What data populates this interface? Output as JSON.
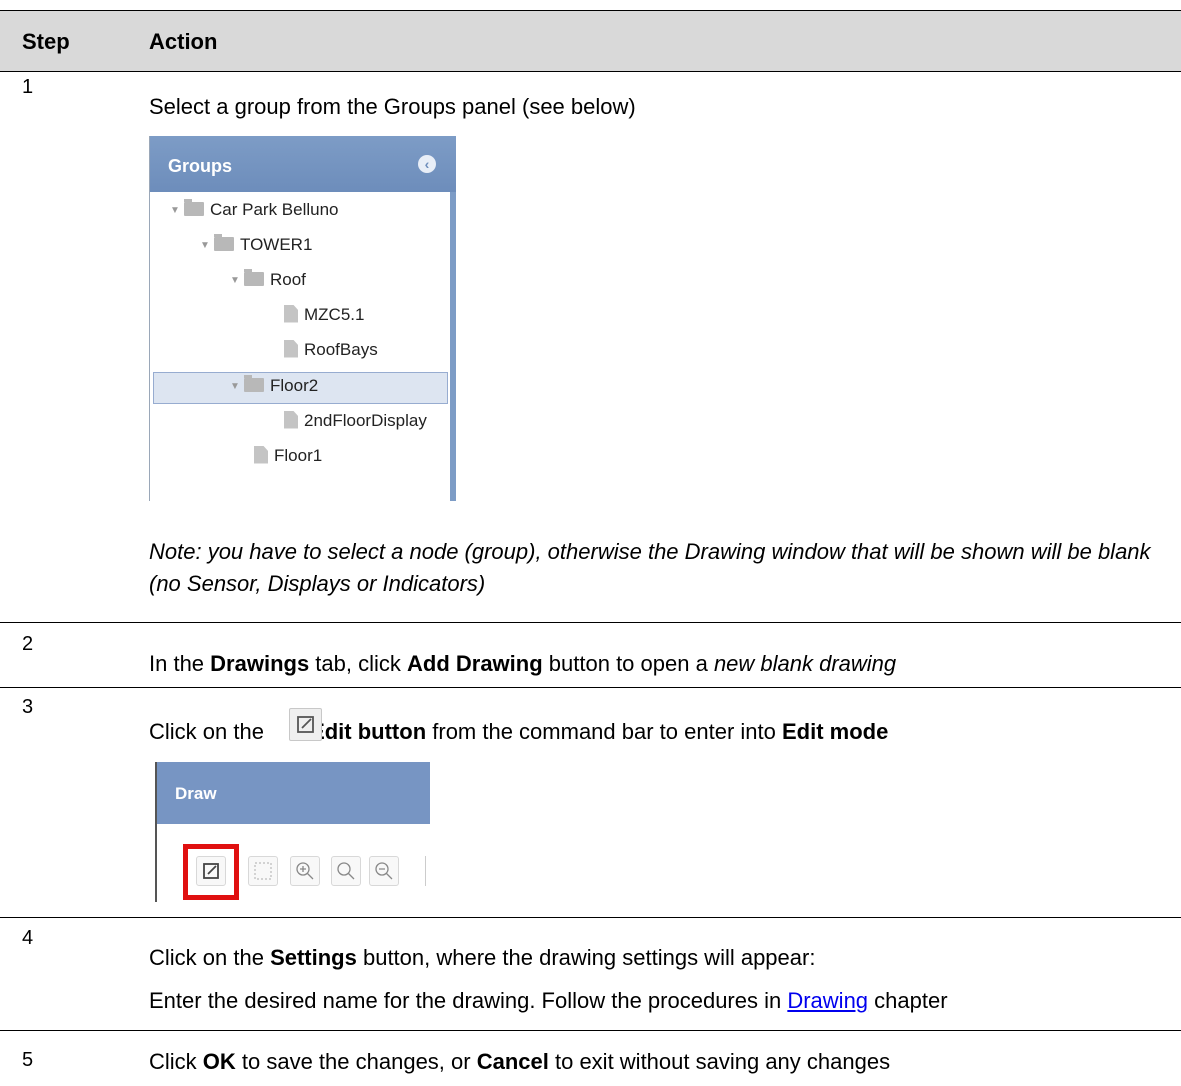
{
  "table": {
    "header": {
      "step": "Step",
      "action": "Action"
    },
    "steps": [
      {
        "num": "1",
        "text": "Select a group from the Groups panel (see below)",
        "note": "Note: you have to select a node (group), otherwise the Drawing window that will be shown will be blank (no Sensor, Displays or Indicators)"
      },
      {
        "num": "2",
        "t1": "In the ",
        "b1": "Drawings",
        "t2": " tab, click ",
        "b2": "Add Drawing",
        "t3": " button to open a ",
        "i1": "new blank drawing"
      },
      {
        "num": "3",
        "t1": "Click on the ",
        "b1": "Edit button",
        "t2": " from the command bar to enter into ",
        "b2": "Edit mode"
      },
      {
        "num": "4",
        "t1": "Click on the ",
        "b1": "Settings",
        "t2": " button, where the drawing settings will appear:",
        "line2_t1": "Enter the desired name for the drawing. Follow the procedures in ",
        "line2_link": "Drawing",
        "line2_t2": " chapter"
      },
      {
        "num": "5",
        "t1": "Click ",
        "b1": "OK",
        "t2": " to save the changes, or ",
        "b2": "Cancel",
        "t3": " to exit without saving any changes"
      }
    ]
  },
  "groups_panel": {
    "title": "Groups",
    "collapse_icon": "chevron-left-circle-icon",
    "nodes": [
      {
        "label": "Car Park Belluno",
        "type": "folder",
        "expanded": true
      },
      {
        "label": "TOWER1",
        "type": "folder",
        "expanded": true
      },
      {
        "label": "Roof",
        "type": "folder",
        "expanded": true
      },
      {
        "label": "MZC5.1",
        "type": "file"
      },
      {
        "label": "RoofBays",
        "type": "file"
      },
      {
        "label": "Floor2",
        "type": "folder",
        "expanded": true,
        "selected": true
      },
      {
        "label": "2ndFloorDisplay",
        "type": "file"
      },
      {
        "label": "Floor1",
        "type": "file"
      }
    ]
  },
  "draw_panel": {
    "title": "Draw",
    "tools": [
      "edit-icon",
      "select-rect-icon",
      "zoom-in-icon",
      "zoom-icon",
      "zoom-out-icon"
    ],
    "highlight": "#e01010"
  }
}
